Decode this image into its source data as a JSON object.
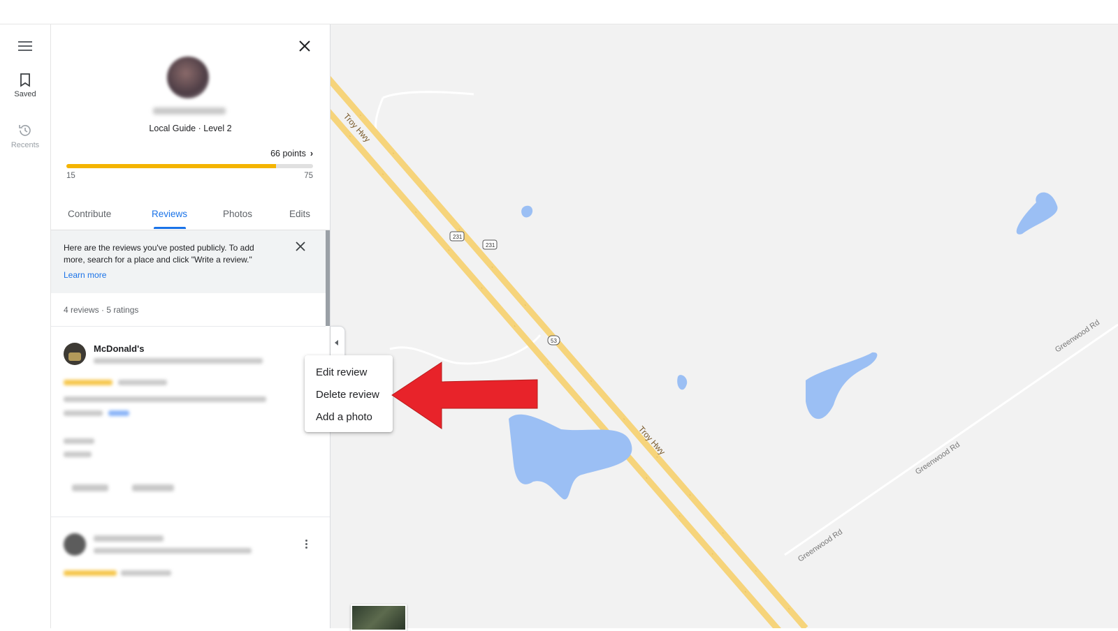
{
  "rail": {
    "saved_label": "Saved",
    "recents_label": "Recents"
  },
  "profile": {
    "guide_text": "Local Guide · Level 2",
    "points_text": "66 points",
    "progress": {
      "min_label": "15",
      "max_label": "75",
      "current": 66,
      "min": 15,
      "max": 75
    }
  },
  "tabs": [
    {
      "label": "Contribute",
      "active": false
    },
    {
      "label": "Reviews",
      "active": true
    },
    {
      "label": "Photos",
      "active": false
    },
    {
      "label": "Edits",
      "active": false
    }
  ],
  "notice": {
    "text": "Here are the reviews you've posted publicly. To add more, search for a place and click \"Write a review.\"",
    "link": "Learn more"
  },
  "summary": "4 reviews · 5 ratings",
  "reviews": [
    {
      "place": "McDonald's"
    }
  ],
  "context_menu": {
    "items": [
      "Edit review",
      "Delete review",
      "Add a photo"
    ]
  },
  "map": {
    "road_labels": [
      "Troy Hwy",
      "Troy Hwy",
      "Greenwood Rd",
      "Greenwood Rd",
      "Greenwood Rd"
    ],
    "shields": [
      "231",
      "231",
      "53"
    ]
  },
  "colors": {
    "accent": "#1a73e8",
    "progress_fill": "#f4b400",
    "road": "#f6d47b",
    "water": "#9bbff4",
    "annotation_arrow": "#e8232a"
  }
}
